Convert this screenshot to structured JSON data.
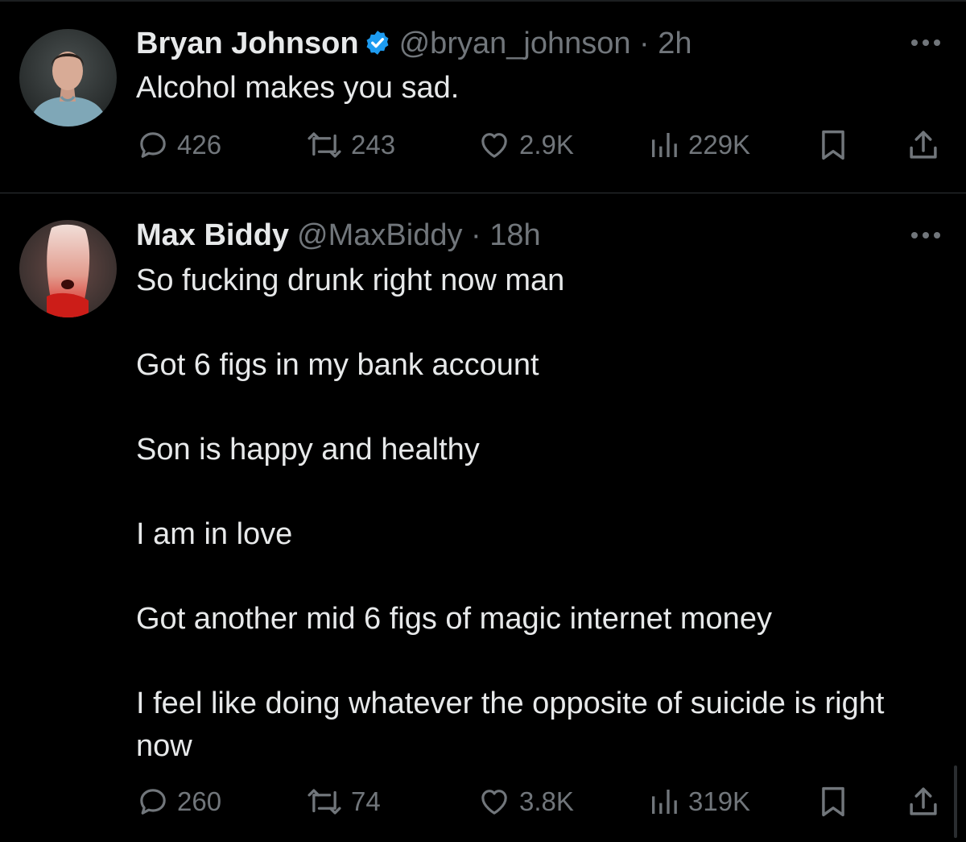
{
  "tweets": [
    {
      "author": {
        "name": "Bryan Johnson",
        "verified": true,
        "handle": "@bryan_johnson",
        "avatar_icon": "person-photo"
      },
      "separator": "·",
      "time": "2h",
      "text": [
        "Alcohol makes you sad."
      ],
      "stats": {
        "replies": "426",
        "reposts": "243",
        "likes": "2.9K",
        "views": "229K"
      }
    },
    {
      "author": {
        "name": "Max Biddy",
        "verified": false,
        "handle": "@MaxBiddy",
        "avatar_icon": "abstract-red-figure-photo"
      },
      "separator": "·",
      "time": "18h",
      "text": [
        "So fucking drunk right now man",
        "Got 6 figs in my bank account",
        "Son is happy and healthy",
        "I am in love",
        "Got another mid 6 figs of magic internet money",
        "I feel like doing whatever the opposite of suicide is right now"
      ],
      "stats": {
        "replies": "260",
        "reposts": "74",
        "likes": "3.8K",
        "views": "319K"
      }
    }
  ],
  "icons": {
    "more": "more-horizontal-icon",
    "reply": "reply-bubble-icon",
    "repost": "repost-icon",
    "like": "heart-icon",
    "views": "bar-chart-icon",
    "bookmark": "bookmark-icon",
    "share": "share-icon",
    "verified": "verified-badge-icon"
  },
  "colors": {
    "background": "#000000",
    "text": "#e7e9ea",
    "secondary": "#71767b",
    "divider": "#2f3336",
    "verified": "#1d9bf0"
  }
}
